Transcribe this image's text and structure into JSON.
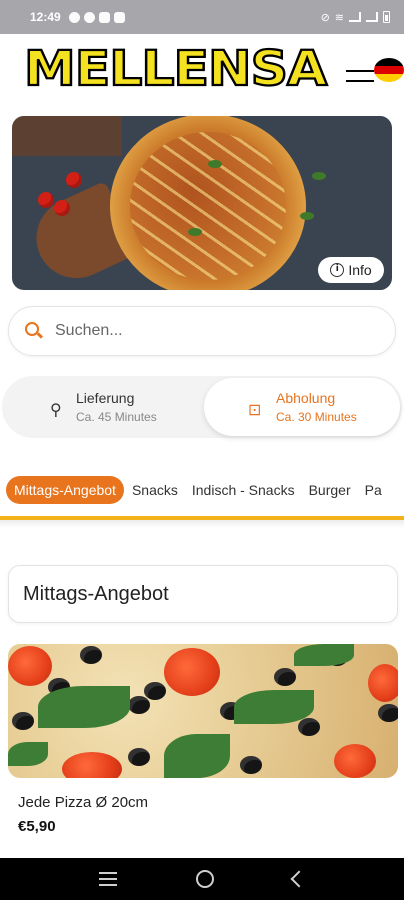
{
  "status_bar": {
    "time": "12:49",
    "icons_left": [
      "notification-icon",
      "notification-icon",
      "mail-icon",
      "mail-icon"
    ],
    "icons_right": [
      "mute-icon",
      "wifi-icon",
      "signal-icon",
      "signal-icon",
      "battery-icon"
    ]
  },
  "brand": {
    "logo_text": "MELLENSA",
    "flag_colors": [
      "#000000",
      "#dd0000",
      "#ffce00"
    ]
  },
  "hero": {
    "info_label": "Info"
  },
  "search": {
    "placeholder": "Suchen..."
  },
  "delivery": {
    "options": [
      {
        "title": "Lieferung",
        "subtitle": "Ca. 45 Minutes",
        "icon": "bike-icon",
        "selected": false
      },
      {
        "title": "Abholung",
        "subtitle": "Ca. 30 Minutes",
        "icon": "bag-icon",
        "selected": true
      }
    ]
  },
  "categories": {
    "items": [
      "Mittags-Angebot",
      "Snacks",
      "Indisch - Snacks",
      "Burger",
      "Pa"
    ],
    "active": "Mittags-Angebot"
  },
  "section": {
    "title": "Mittags-Angebot"
  },
  "products": [
    {
      "name": "Jede Pizza Ø 20cm",
      "price": "€5,90"
    }
  ],
  "colors": {
    "accent": "#e8741e",
    "category_underline": "#f3b21a",
    "logo_fill": "#f4e11f"
  }
}
